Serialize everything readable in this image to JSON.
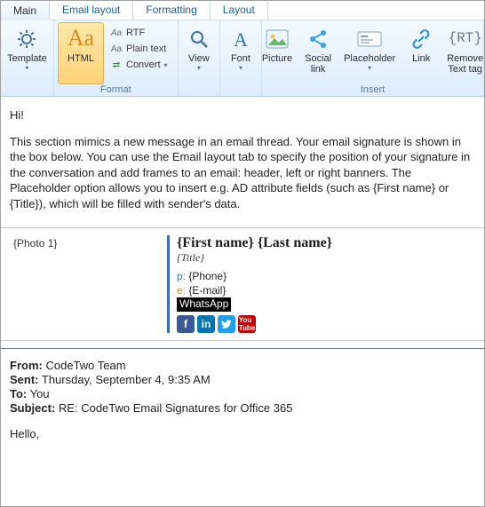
{
  "tabs": {
    "main": "Main",
    "email_layout": "Email layout",
    "formatting": "Formatting",
    "layout": "Layout"
  },
  "ribbon": {
    "template": "Template",
    "html": "HTML",
    "rtf": "RTF",
    "plain": "Plain text",
    "convert": "Convert",
    "view": "View",
    "font": "Font",
    "picture": "Picture",
    "social": "Social\nlink",
    "placeholder": "Placeholder",
    "link": "Link",
    "remove": "Remove\nText tag",
    "group_format": "Format",
    "group_insert": "Insert"
  },
  "body": {
    "hi": "Hi!",
    "para": "This section mimics a new message in an email thread. Your email signature is shown in the box below. You can use the Email layout tab to specify the position of your signature in the conversation and add frames to an email: header, left or right banners. The Placeholder option allows you to insert e.g. AD attribute fields (such as {First name} or {Title}), which will be filled with sender's data."
  },
  "sig": {
    "photo": "{Photo 1}",
    "name": "{First name} {Last name}",
    "title": "{Title}",
    "phone_label": "p:",
    "phone_val": "{Phone}",
    "email_label": "e:",
    "email_val": "{E-mail}",
    "whatsapp": "WhatsApp"
  },
  "quoted": {
    "from_l": "From:",
    "from_v": "CodeTwo Team",
    "sent_l": "Sent:",
    "sent_v": "Thursday, September 4, 9:35 AM",
    "to_l": "To:",
    "to_v": "You",
    "subj_l": "Subject:",
    "subj_v": "RE: CodeTwo Email Signatures for Office 365",
    "hello": "Hello,"
  }
}
